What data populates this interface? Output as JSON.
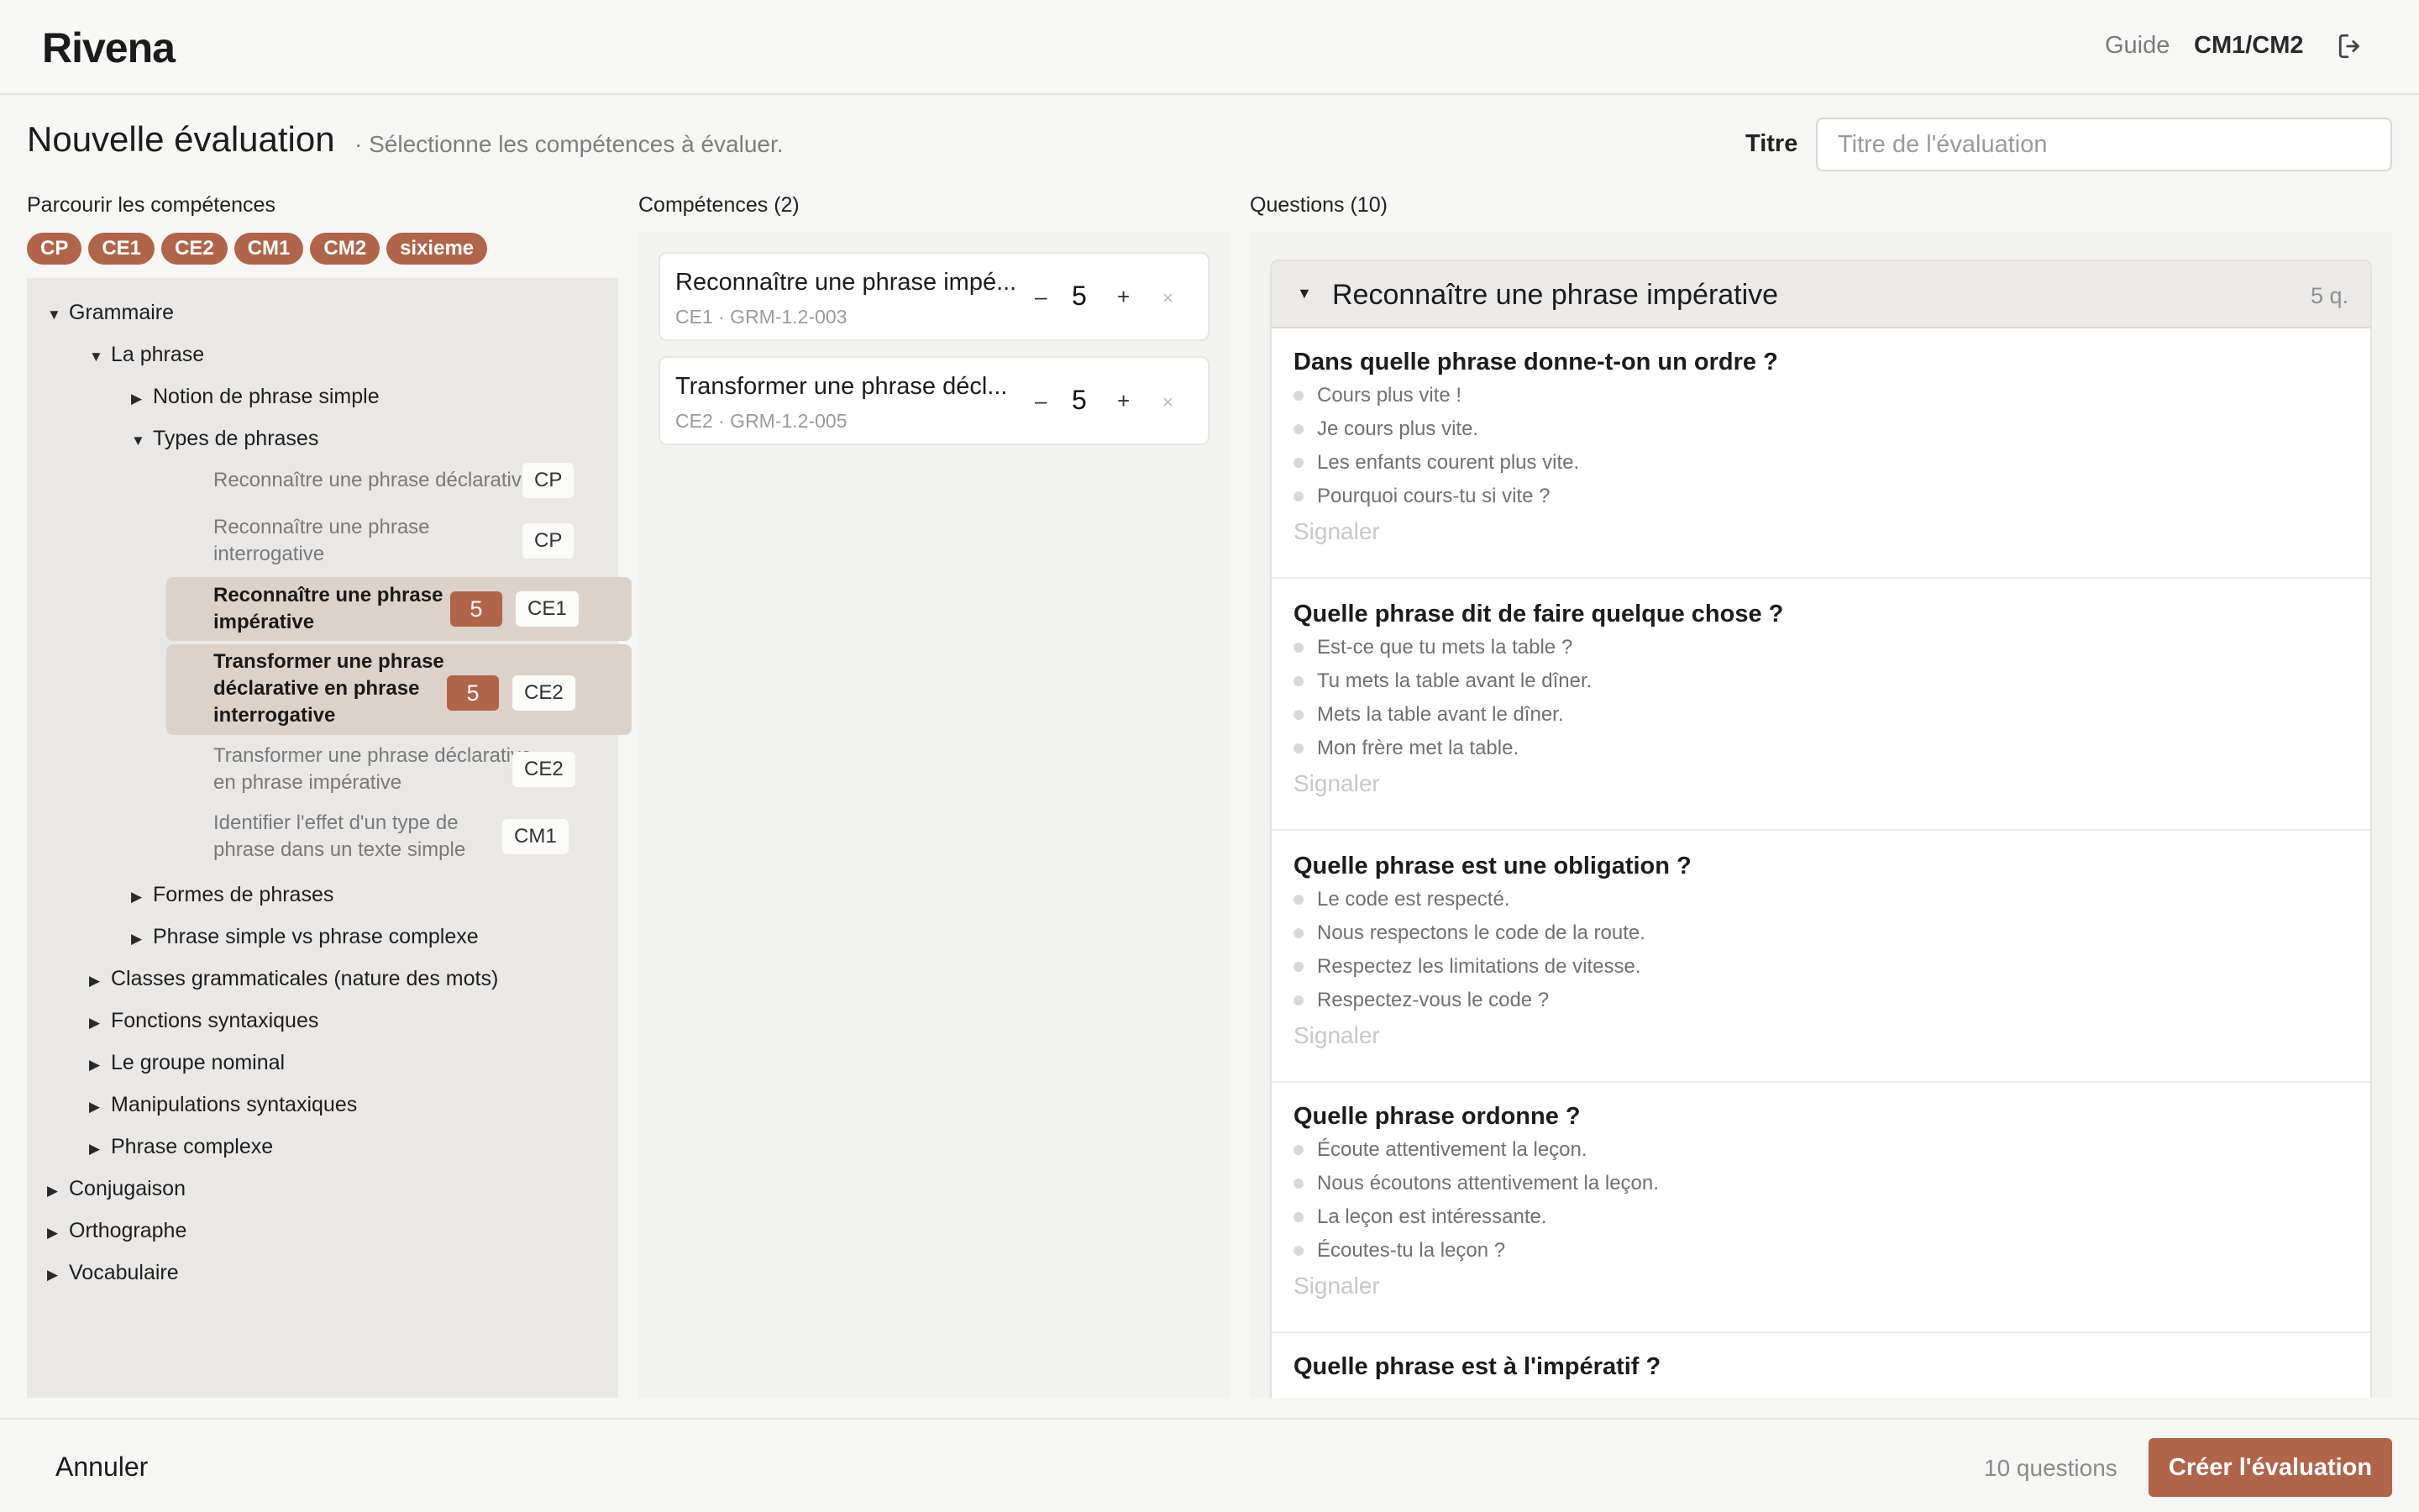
{
  "header": {
    "logo": "Rivena",
    "guide_link": "Guide",
    "class_label": "CM1/CM2",
    "logout_icon": "logout-icon"
  },
  "page": {
    "title": "Nouvelle évaluation",
    "subtitle": "· Sélectionne les compétences à évaluer.",
    "titre_label": "Titre",
    "titre_placeholder": "Titre de l'évaluation"
  },
  "browse": {
    "heading": "Parcourir les compétences",
    "levels": [
      "CP",
      "CE1",
      "CE2",
      "CM1",
      "CM2",
      "sixieme"
    ],
    "tree": {
      "grammaire": "Grammaire",
      "la_phrase": "La phrase",
      "notion": "Notion de phrase simple",
      "types": "Types de phrases",
      "leaves": [
        {
          "line1": "Reconnaître une phrase déclarative",
          "line2": "",
          "line3": "",
          "level": "CP",
          "count": ""
        },
        {
          "line1": "Reconnaître une phrase",
          "line2": "interrogative",
          "line3": "",
          "level": "CP",
          "count": ""
        },
        {
          "line1": "Reconnaître une phrase",
          "line2": "impérative",
          "line3": "",
          "level": "CE1",
          "count": "5"
        },
        {
          "line1": "Transformer une phrase",
          "line2": "déclarative en phrase",
          "line3": "interrogative",
          "level": "CE2",
          "count": "5"
        },
        {
          "line1": "Transformer une phrase déclarative",
          "line2": "en phrase impérative",
          "line3": "",
          "level": "CE2",
          "count": ""
        },
        {
          "line1": "Identifier l'effet d'un type de",
          "line2": "phrase dans un texte simple",
          "line3": "",
          "level": "CM1",
          "count": ""
        }
      ],
      "formes": "Formes de phrases",
      "simple_complexe": "Phrase simple vs phrase complexe",
      "classes": "Classes grammaticales (nature des mots)",
      "fonctions": "Fonctions syntaxiques",
      "groupe_nominal": "Le groupe nominal",
      "manipulations": "Manipulations syntaxiques",
      "phrase_complexe": "Phrase complexe",
      "conjugaison": "Conjugaison",
      "orthographe": "Orthographe",
      "vocabulaire": "Vocabulaire"
    }
  },
  "competences": {
    "heading": "Compétences (2)",
    "items": [
      {
        "name": "Reconnaître une phrase impé...",
        "code": "CE1 · GRM-1.2-003",
        "minus": "–",
        "value": "5",
        "plus": "+",
        "remove": "×"
      },
      {
        "name": "Transformer une phrase décl...",
        "code": "CE2 · GRM-1.2-005",
        "minus": "–",
        "value": "5",
        "plus": "+",
        "remove": "×"
      }
    ]
  },
  "questions": {
    "heading": "Questions (10)",
    "group_title": "Reconnaître une phrase impérative",
    "group_count": "5 q.",
    "report_label": "Signaler",
    "items": [
      {
        "title": "Dans quelle phrase donne-t-on un ordre ?",
        "options": [
          "Cours plus vite !",
          "Je cours plus vite.",
          "Les enfants courent plus vite.",
          "Pourquoi cours-tu si vite ?"
        ]
      },
      {
        "title": "Quelle phrase dit de faire quelque chose ?",
        "options": [
          "Est-ce que tu mets la table ?",
          "Tu mets la table avant le dîner.",
          "Mets la table avant le dîner.",
          "Mon frère met la table."
        ]
      },
      {
        "title": "Quelle phrase est une obligation ?",
        "options": [
          "Le code est respecté.",
          "Nous respectons le code de la route.",
          "Respectez les limitations de vitesse.",
          "Respectez-vous le code ?"
        ]
      },
      {
        "title": "Quelle phrase ordonne ?",
        "options": [
          "Écoute attentivement la leçon.",
          "Nous écoutons attentivement la leçon.",
          "La leçon est intéressante.",
          "Écoutes-tu la leçon ?"
        ]
      },
      {
        "title": "Quelle phrase est à l'impératif ?",
        "options": []
      }
    ]
  },
  "footer": {
    "cancel": "Annuler",
    "total": "10 questions",
    "create": "Créer l'évaluation"
  },
  "colors": {
    "accent": "#b0644a",
    "selected_row": "#ddd2ca",
    "panel": "#e9e8e6"
  }
}
